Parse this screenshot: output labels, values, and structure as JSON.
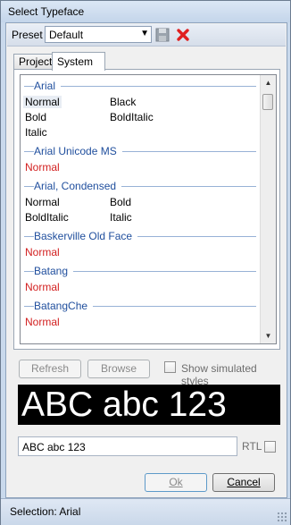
{
  "window": {
    "title": "Select Typeface"
  },
  "preset": {
    "label": "Preset",
    "selected": "Default",
    "save_icon": "save-icon",
    "delete_icon": "delete-x-icon",
    "accent_delete": "#e02020"
  },
  "tabs": [
    {
      "label": "Project",
      "active": false
    },
    {
      "label": "System",
      "active": true
    }
  ],
  "font_list": {
    "families": [
      {
        "name": "Arial",
        "rows": [
          [
            "Normal",
            "Black"
          ],
          [
            "Bold",
            "BoldItalic"
          ],
          [
            "Italic",
            ""
          ]
        ],
        "red": false,
        "selected_style": "Normal"
      },
      {
        "name": "Arial Unicode MS",
        "rows": [
          [
            "Normal",
            ""
          ]
        ],
        "red": true
      },
      {
        "name": "Arial, Condensed",
        "rows": [
          [
            "Normal",
            "Bold"
          ],
          [
            "BoldItalic",
            "Italic"
          ]
        ],
        "red": false
      },
      {
        "name": "Baskerville Old Face",
        "rows": [
          [
            "Normal",
            ""
          ]
        ],
        "red": true
      },
      {
        "name": "Batang",
        "rows": [
          [
            "Normal",
            ""
          ]
        ],
        "red": true
      },
      {
        "name": "BatangChe",
        "rows": [
          [
            "Normal",
            ""
          ]
        ],
        "red": true
      }
    ],
    "family_color": "#1f4e9d",
    "unavailable_color": "#d21f1f"
  },
  "buttons": {
    "refresh": "Refresh",
    "browse": "Browse",
    "show_simulated": "Show simulated styles",
    "ok": "Ok",
    "cancel": "Cancel"
  },
  "preview": {
    "text": "ABC abc 123"
  },
  "sample": {
    "value": "ABC abc 123",
    "rtl_label": "RTL"
  },
  "status": {
    "selection": "Selection:  Arial"
  }
}
